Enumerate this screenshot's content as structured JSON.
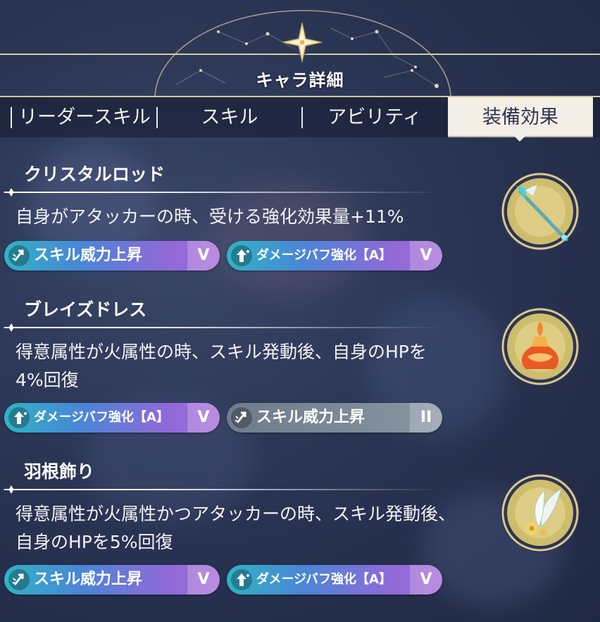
{
  "header": {
    "title": "キャラ詳細"
  },
  "tabs": [
    {
      "label": "リーダースキル",
      "active": false
    },
    {
      "label": "スキル",
      "active": false
    },
    {
      "label": "アビリティ",
      "active": false
    },
    {
      "label": "装備効果",
      "active": true
    }
  ],
  "equipment": [
    {
      "name": "クリスタルロッド",
      "desc_lines": [
        "自身がアタッカーの時、受ける強化効果量+11%"
      ],
      "icon": "crystal-rod-icon",
      "tags": [
        {
          "label": "スキル威力上昇",
          "level": "V",
          "style": "violet",
          "icon": "skill-power-icon"
        },
        {
          "label": "ダメージバフ強化【A】",
          "level": "V",
          "style": "violet",
          "icon": "damage-buff-icon"
        }
      ]
    },
    {
      "name": "ブレイズドレス",
      "desc_lines": [
        "得意属性が火属性の時、スキル発動後、自身のHPを",
        "4%回復"
      ],
      "icon": "blaze-dress-icon",
      "tags": [
        {
          "label": "ダメージバフ強化【A】",
          "level": "V",
          "style": "violet",
          "icon": "damage-buff-icon"
        },
        {
          "label": "スキル威力上昇",
          "level": "II",
          "style": "grey",
          "icon": "skill-power-icon"
        }
      ]
    },
    {
      "name": "羽根飾り",
      "desc_lines": [
        "得意属性が火属性かつアタッカーの時、スキル発動後、",
        "自身のHPを5%回復"
      ],
      "icon": "feather-ornament-icon",
      "tags": [
        {
          "label": "スキル威力上昇",
          "level": "V",
          "style": "violet",
          "icon": "skill-power-icon"
        },
        {
          "label": "ダメージバフ強化【A】",
          "level": "V",
          "style": "violet",
          "icon": "damage-buff-icon"
        }
      ]
    }
  ],
  "colors": {
    "accent_gold": "#d8c99a",
    "active_tab": "#f3efe6",
    "chip_violet": "#8e6ad8",
    "chip_grey": "#7d8a97"
  }
}
